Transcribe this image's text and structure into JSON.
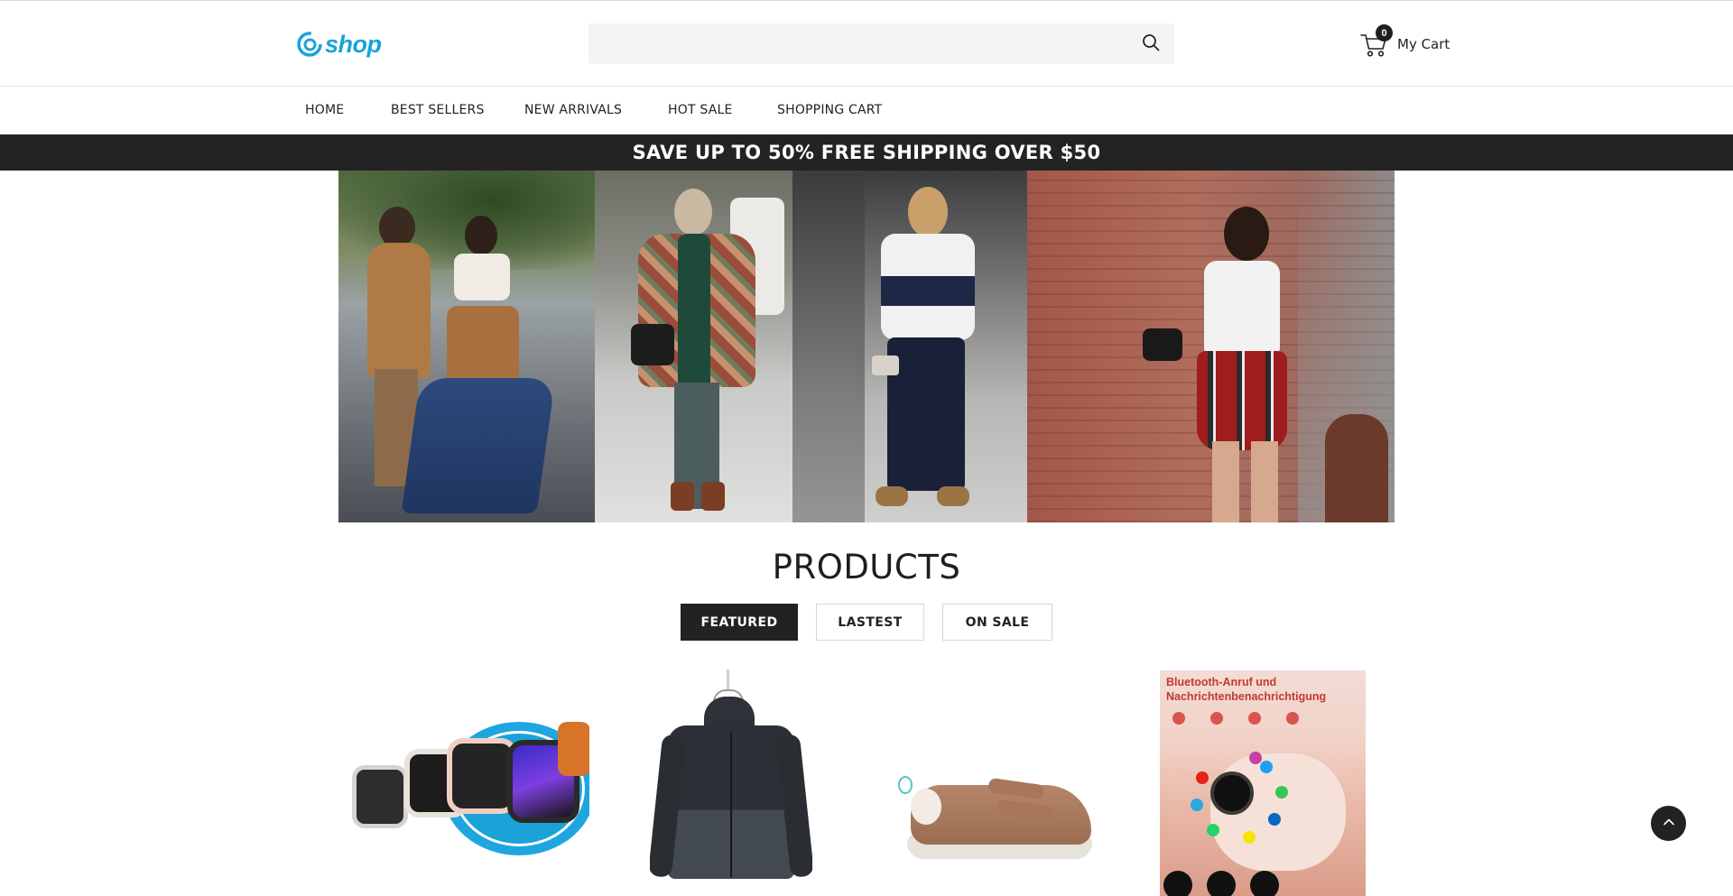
{
  "brand": {
    "logo_text": "shop",
    "logo_icon": "swirl-logo-icon",
    "accent_color": "#1aa3d9"
  },
  "search": {
    "value": "",
    "placeholder": "",
    "icon": "search-icon"
  },
  "cart": {
    "count": "0",
    "label": "My Cart",
    "icon": "shopping-cart-icon"
  },
  "nav": {
    "items": [
      {
        "label": "HOME"
      },
      {
        "label": "BEST SELLERS"
      },
      {
        "label": "NEW ARRIVALS"
      },
      {
        "label": "HOT SALE"
      },
      {
        "label": "SHOPPING CART"
      }
    ]
  },
  "announcement": {
    "text": "SAVE UP TO 50% FREE SHIPPING OVER $50",
    "background": "#232323"
  },
  "products": {
    "title": "PRODUCTS",
    "tabs": [
      {
        "label": "FEATURED",
        "active": true
      },
      {
        "label": "LASTEST",
        "active": false
      },
      {
        "label": "ON SALE",
        "active": false
      }
    ],
    "items": [
      {
        "image": "smartwatches-image"
      },
      {
        "image": "hooded-jacket-image"
      },
      {
        "image": "leather-sneaker-image"
      },
      {
        "image": "smartwatch-promo-image",
        "promo_text": "Bluetooth-Anruf und Nachrichtenbenachrichtigung"
      }
    ]
  },
  "back_to_top": {
    "icon": "chevron-up-icon"
  }
}
